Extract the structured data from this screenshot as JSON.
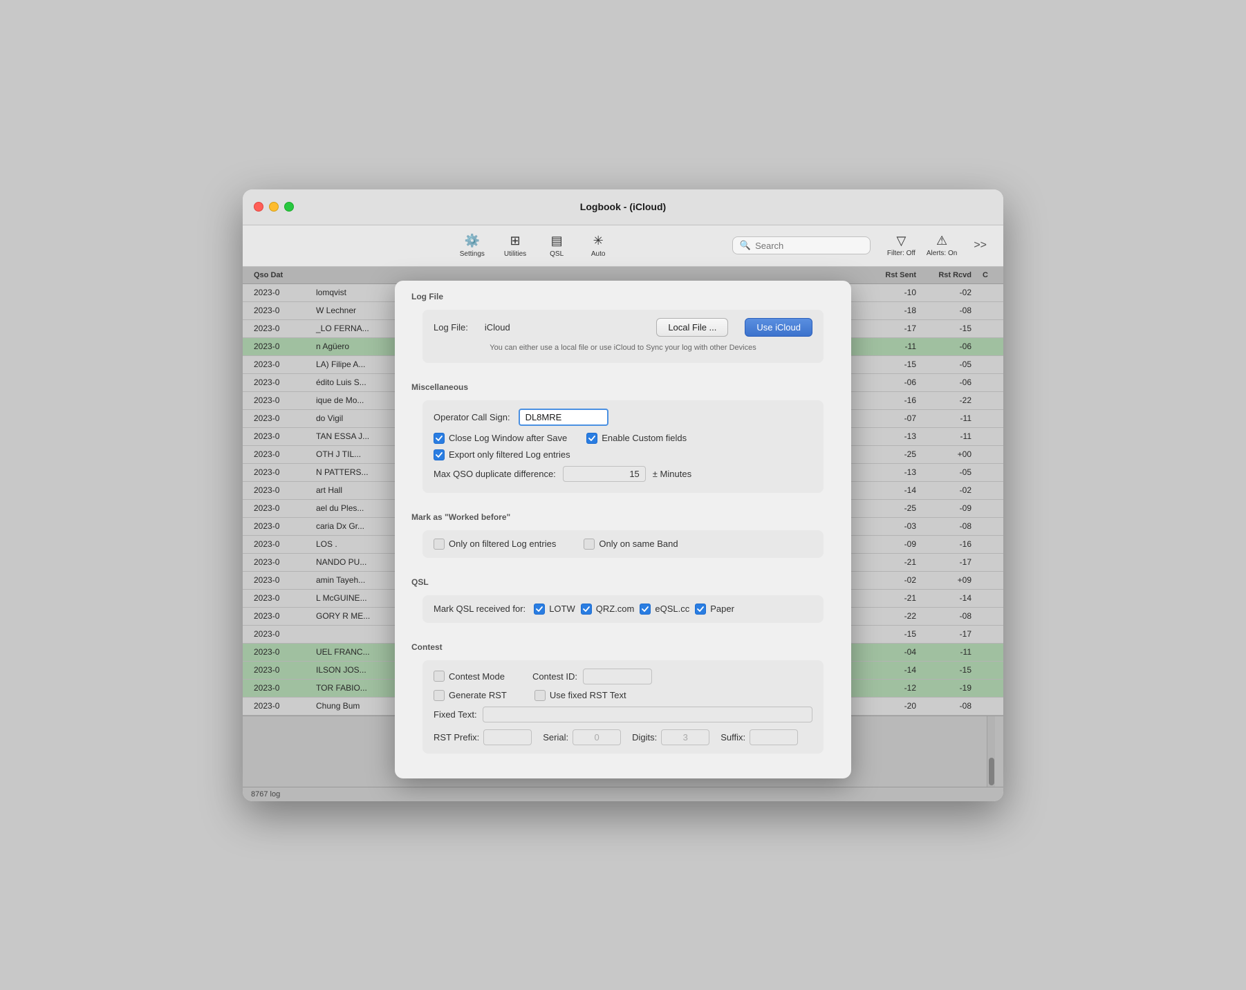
{
  "window": {
    "title": "Logbook - (iCloud)"
  },
  "toolbar": {
    "settings_label": "Settings",
    "utilities_label": "Utilities",
    "qsl_label": "QSL",
    "auto_label": "Auto",
    "search_placeholder": "Search",
    "filter_label": "Filter: Off",
    "alerts_label": "Alerts: On",
    "more_label": ">>"
  },
  "table": {
    "headers": [
      "Qso Dat",
      "Rst Sent",
      "Rst Rcvd",
      "C"
    ],
    "rows": [
      {
        "date": "2023-0",
        "name": "lomqvist",
        "rst_sent": "-10",
        "rst_rcvd": "-02",
        "green": false
      },
      {
        "date": "2023-0",
        "name": "W Lechner",
        "rst_sent": "-18",
        "rst_rcvd": "-08",
        "green": false
      },
      {
        "date": "2023-0",
        "name": "_LO FERNA...",
        "rst_sent": "-17",
        "rst_rcvd": "-15",
        "green": false
      },
      {
        "date": "2023-0",
        "name": "n Agüero",
        "rst_sent": "-11",
        "rst_rcvd": "-06",
        "green": true
      },
      {
        "date": "2023-0",
        "name": "LA) Filipe A...",
        "rst_sent": "-15",
        "rst_rcvd": "-05",
        "green": false
      },
      {
        "date": "2023-0",
        "name": "édito Luis S...",
        "rst_sent": "-06",
        "rst_rcvd": "-06",
        "green": false
      },
      {
        "date": "2023-0",
        "name": "ique de Mo...",
        "rst_sent": "-16",
        "rst_rcvd": "-22",
        "green": false
      },
      {
        "date": "2023-0",
        "name": "do Vigil",
        "rst_sent": "-07",
        "rst_rcvd": "-11",
        "green": false
      },
      {
        "date": "2023-0",
        "name": "TAN ESSA J...",
        "rst_sent": "-13",
        "rst_rcvd": "-11",
        "green": false
      },
      {
        "date": "2023-0",
        "name": "OTH J TIL...",
        "rst_sent": "-25",
        "rst_rcvd": "+00",
        "green": false
      },
      {
        "date": "2023-0",
        "name": "N PATTERS...",
        "rst_sent": "-13",
        "rst_rcvd": "-05",
        "green": false
      },
      {
        "date": "2023-0",
        "name": "art Hall",
        "rst_sent": "-14",
        "rst_rcvd": "-02",
        "green": false
      },
      {
        "date": "2023-0",
        "name": "ael du Ples...",
        "rst_sent": "-25",
        "rst_rcvd": "-09",
        "green": false
      },
      {
        "date": "2023-0",
        "name": "caria Dx Gr...",
        "rst_sent": "-03",
        "rst_rcvd": "-08",
        "green": false
      },
      {
        "date": "2023-0",
        "name": "LOS .",
        "rst_sent": "-09",
        "rst_rcvd": "-16",
        "green": false
      },
      {
        "date": "2023-0",
        "name": "NANDO PU...",
        "rst_sent": "-21",
        "rst_rcvd": "-17",
        "green": false
      },
      {
        "date": "2023-0",
        "name": "amin Tayeh...",
        "rst_sent": "-02",
        "rst_rcvd": "+09",
        "green": false
      },
      {
        "date": "2023-0",
        "name": "L McGUINE...",
        "rst_sent": "-21",
        "rst_rcvd": "-14",
        "green": false
      },
      {
        "date": "2023-0",
        "name": "GORY R ME...",
        "rst_sent": "-22",
        "rst_rcvd": "-08",
        "green": false
      },
      {
        "date": "2023-0",
        "name": "",
        "rst_sent": "-15",
        "rst_rcvd": "-17",
        "green": false
      },
      {
        "date": "2023-0",
        "name": "UEL FRANC...",
        "rst_sent": "-04",
        "rst_rcvd": "-11",
        "green": true
      },
      {
        "date": "2023-0",
        "name": "ILSON JOS...",
        "rst_sent": "-14",
        "rst_rcvd": "-15",
        "green": true
      },
      {
        "date": "2023-0",
        "name": "TOR FABIO...",
        "rst_sent": "-12",
        "rst_rcvd": "-19",
        "green": true
      },
      {
        "date": "2023-0",
        "name": "Chung Bum",
        "rst_sent": "-20",
        "rst_rcvd": "-08",
        "green": false
      }
    ],
    "status": "8767 log"
  },
  "modal": {
    "log_file_section": "Log File",
    "log_file_label": "Log File:",
    "log_file_value": "iCloud",
    "local_file_btn": "Local File ...",
    "use_icloud_btn": "Use iCloud",
    "log_file_hint": "You can either use a local file or use iCloud to Sync your log with other Devices",
    "misc_section": "Miscellaneous",
    "operator_call_label": "Operator Call Sign:",
    "operator_call_value": "DL8MRE",
    "close_log_label": "Close Log Window after Save",
    "close_log_checked": true,
    "enable_custom_label": "Enable Custom fields",
    "enable_custom_checked": true,
    "export_filtered_label": "Export only filtered Log entries",
    "export_filtered_checked": true,
    "max_qso_label": "Max QSO duplicate difference:",
    "max_qso_value": "15",
    "max_qso_unit": "± Minutes",
    "worked_before_section": "Mark as \"Worked before\"",
    "only_filtered_label": "Only on filtered Log entries",
    "only_filtered_checked": false,
    "only_same_band_label": "Only on same Band",
    "only_same_band_checked": false,
    "qsl_section": "QSL",
    "mark_qsl_label": "Mark QSL received for:",
    "lotw_label": "LOTW",
    "lotw_checked": true,
    "qrz_label": "QRZ.com",
    "qrz_checked": true,
    "eqsl_label": "eQSL.cc",
    "eqsl_checked": true,
    "paper_label": "Paper",
    "paper_checked": true,
    "contest_section": "Contest",
    "contest_mode_label": "Contest Mode",
    "contest_mode_checked": false,
    "contest_id_label": "Contest ID:",
    "contest_id_value": "",
    "generate_rst_label": "Generate RST",
    "generate_rst_checked": false,
    "fixed_rst_label": "Use fixed RST Text",
    "fixed_rst_checked": false,
    "fixed_text_label": "Fixed Text:",
    "fixed_text_value": "",
    "rst_prefix_label": "RST Prefix:",
    "rst_prefix_value": "",
    "serial_label": "Serial:",
    "serial_value": "0",
    "digits_label": "Digits:",
    "digits_value": "3",
    "suffix_label": "Suffix:",
    "suffix_value": ""
  }
}
